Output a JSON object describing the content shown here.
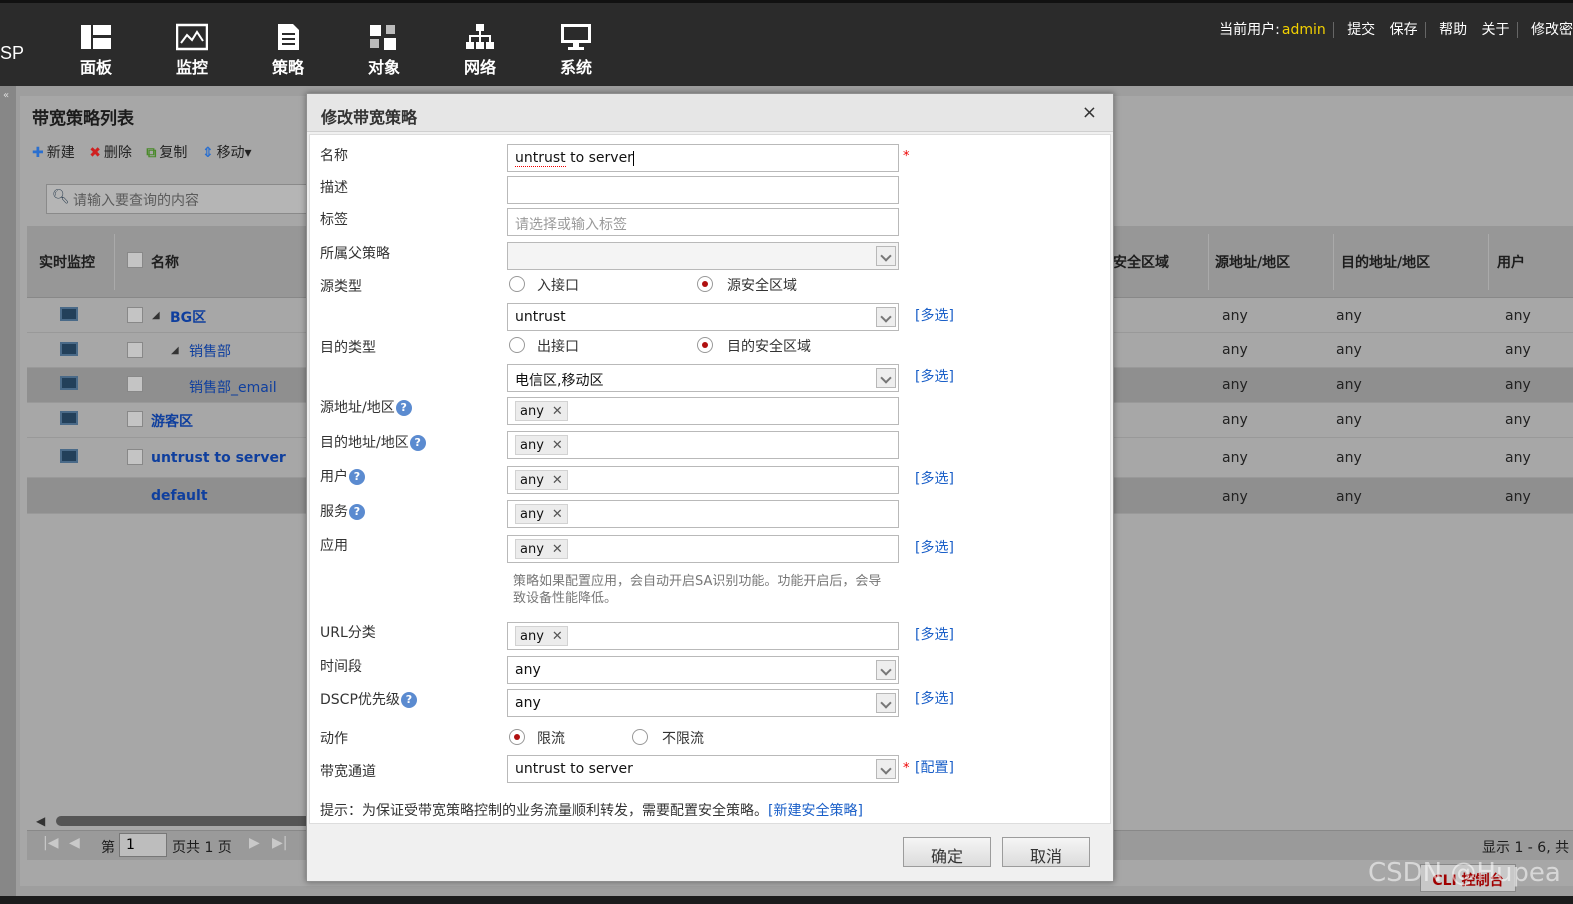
{
  "topbar": {
    "brand": "SP",
    "nav": [
      {
        "label": "面板",
        "icon": "dashboard-icon"
      },
      {
        "label": "监控",
        "icon": "monitor-chart-icon"
      },
      {
        "label": "策略",
        "icon": "policy-document-icon"
      },
      {
        "label": "对象",
        "icon": "objects-icon"
      },
      {
        "label": "网络",
        "icon": "network-icon"
      },
      {
        "label": "系统",
        "icon": "system-screen-icon"
      }
    ],
    "user_label": "当前用户:",
    "user_name": "admin",
    "actions": [
      "提交",
      "保存",
      "帮助",
      "关于",
      "修改密"
    ]
  },
  "panel": {
    "title": "带宽策略列表",
    "toolbar": [
      "新建",
      "删除",
      "复制",
      "移动▾"
    ],
    "search_placeholder": "请输入要查询的内容",
    "columns": [
      "实时监控",
      "名称",
      "安全区域",
      "源地址/地区",
      "目的地址/地区",
      "用户"
    ],
    "rows": [
      {
        "name": "BG区",
        "src": "any",
        "dst": "any",
        "user": "any"
      },
      {
        "name": "销售部",
        "src": "any",
        "dst": "any",
        "user": "any"
      },
      {
        "name": "销售部_email",
        "src": "any",
        "dst": "any",
        "user": "any"
      },
      {
        "name": "游客区",
        "src": "any",
        "dst": "any",
        "user": "any"
      },
      {
        "name": "untrust to server",
        "src": "any",
        "dst": "any",
        "user": "any"
      },
      {
        "name": "default",
        "src": "any",
        "dst": "any",
        "user": "any"
      }
    ],
    "pager": {
      "page_prefix": "第",
      "page": "1",
      "page_suffix": "页共 1 页",
      "display": "显示 1 - 6, 共"
    }
  },
  "cli_label": "CLI 控制台",
  "watermark": "CSDN @Hupea",
  "dialog": {
    "title": "修改带宽策略",
    "close": "×",
    "labels": {
      "name": "名称",
      "desc": "描述",
      "tag": "标签",
      "parent": "所属父策略",
      "src_type": "源类型",
      "dst_type": "目的类型",
      "src_addr": "源地址/地区",
      "dst_addr": "目的地址/地区",
      "user": "用户",
      "service": "服务",
      "app": "应用",
      "url": "URL分类",
      "time": "时间段",
      "dscp": "DSCP优先级",
      "action": "动作",
      "channel": "带宽通道"
    },
    "values": {
      "name_a": "untrust",
      "name_b": " to ",
      "name_c": "server",
      "desc": "",
      "tag_placeholder": "请选择或输入标签",
      "parent": "",
      "src_zone": "untrust",
      "dst_zone": "电信区,移动区",
      "src_addr_tag": "any",
      "dst_addr_tag": "any",
      "user_tag": "any",
      "service_tag": "any",
      "app_tag": "any",
      "url_tag": "any",
      "time": "any",
      "dscp": "any",
      "channel": "untrust to server"
    },
    "radios": {
      "src_iface": "入接口",
      "src_zone": "源安全区域",
      "dst_iface": "出接口",
      "dst_zone": "目的安全区域",
      "limit": "限流",
      "nolimit": "不限流"
    },
    "links": {
      "multi": "[多选]",
      "config": "[配置]",
      "new_security_policy": "[新建安全策略]"
    },
    "required_mark": "*",
    "app_note": "策略如果配置应用，会自动开启SA识别功能。功能开启后，会导致设备性能降低。",
    "tip": "提示：为保证受带宽策略控制的业务流量顺利转发，需要配置安全策略。",
    "ok": "确定",
    "cancel": "取消"
  }
}
